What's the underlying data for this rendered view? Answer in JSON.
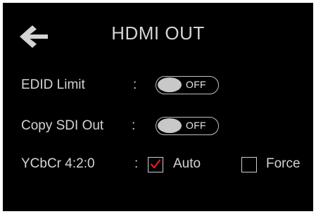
{
  "header": {
    "title": "HDMI OUT",
    "back_icon": "arrow-left-icon"
  },
  "settings": {
    "edid_limit": {
      "label": "EDID Limit",
      "separator": ":",
      "toggle_text": "OFF",
      "state": "off"
    },
    "copy_sdi_out": {
      "label": "Copy SDI Out",
      "separator": ":",
      "toggle_text": "OFF",
      "state": "off"
    },
    "ycbcr": {
      "label": "YCbCr 4:2:0",
      "separator": ":",
      "options": [
        {
          "label": "Auto",
          "checked": true
        },
        {
          "label": "Force",
          "checked": false
        }
      ]
    }
  },
  "colors": {
    "background": "#000000",
    "text": "#d4d4d4",
    "check_mark": "#e02020"
  }
}
